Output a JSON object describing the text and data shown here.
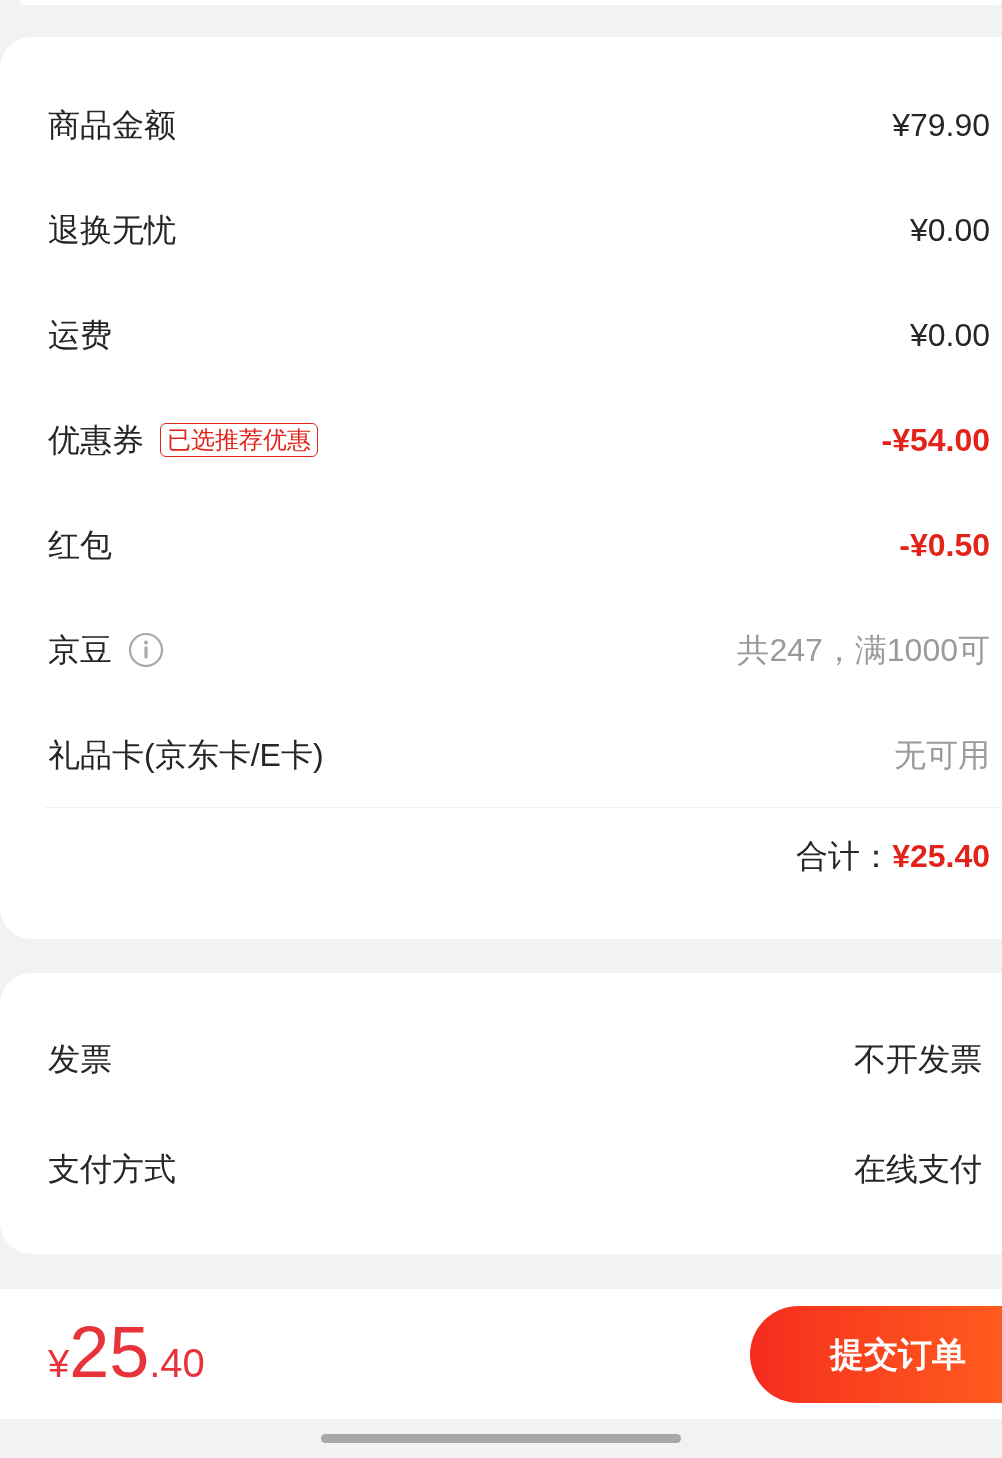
{
  "price_summary": {
    "rows": [
      {
        "label": "商品金额",
        "kind": "amount",
        "value": "¥79.90"
      },
      {
        "label": "退换无忧",
        "kind": "amount",
        "value": "¥0.00"
      },
      {
        "label": "运费",
        "kind": "amount",
        "value": "¥0.00"
      },
      {
        "label": "优惠券",
        "kind": "discount",
        "badge": "已选推荐优惠",
        "value": "-¥54.00"
      },
      {
        "label": "红包",
        "kind": "discount",
        "value": "-¥0.50"
      },
      {
        "label": "京豆",
        "kind": "hint",
        "info_icon": true,
        "value": "共247，满1000可"
      },
      {
        "label": "礼品卡(京东卡/E卡)",
        "kind": "hint",
        "value": "无可用"
      }
    ],
    "total": {
      "label": "合计：",
      "value": "¥25.40"
    }
  },
  "order_options": {
    "rows": [
      {
        "label": "发票",
        "value": "不开发票"
      },
      {
        "label": "支付方式",
        "value": "在线支付"
      }
    ]
  },
  "footer": {
    "price": {
      "currency": "¥",
      "integer": "25",
      "decimal": ".40"
    },
    "submit_button": "提交订单"
  }
}
